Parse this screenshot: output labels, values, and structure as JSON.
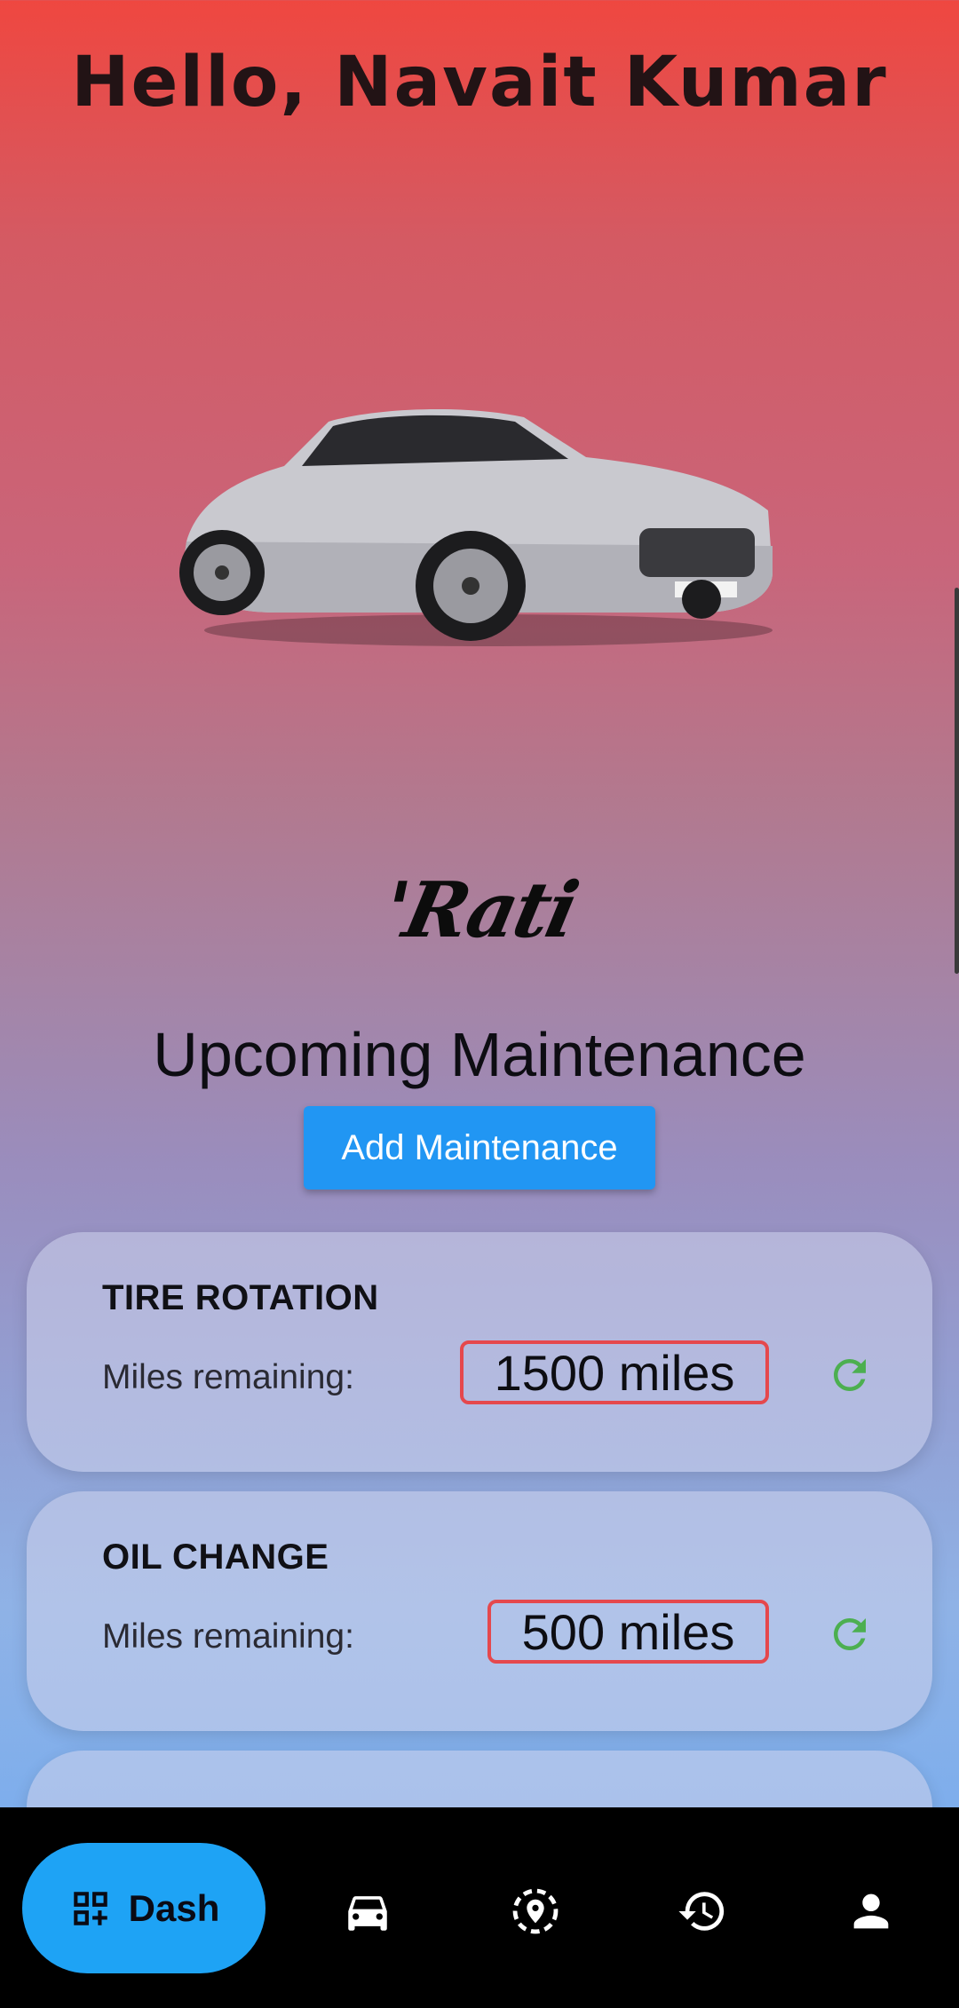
{
  "header": {
    "greeting": "Hello, Navait Kumar"
  },
  "vehicle": {
    "brand_logo_text": "'Rati"
  },
  "maintenance": {
    "title": "Upcoming Maintenance",
    "add_button": "Add Maintenance",
    "items": [
      {
        "name": "TIRE ROTATION",
        "label": "Miles remaining:",
        "value": "1500 miles"
      },
      {
        "name": "OIL CHANGE",
        "label": "Miles remaining:",
        "value": "500 miles"
      }
    ]
  },
  "nav": {
    "items": [
      {
        "label": "Dash",
        "icon": "dashboard-add-icon",
        "active": true
      },
      {
        "icon": "car-icon"
      },
      {
        "icon": "location-pin-icon"
      },
      {
        "icon": "history-icon"
      },
      {
        "icon": "profile-icon"
      }
    ]
  },
  "colors": {
    "accent": "#2196f3",
    "nav_active": "#1ea3f5",
    "miles_border": "#e5484d",
    "refresh": "#4caf50"
  }
}
